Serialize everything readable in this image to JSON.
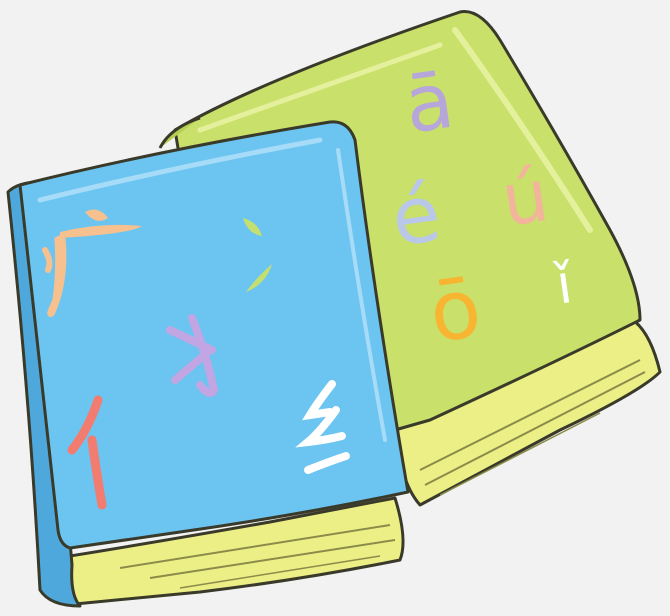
{
  "illustration": {
    "green_book": {
      "letters": [
        {
          "text": "ā",
          "color": "#b7a6d9"
        },
        {
          "text": "é",
          "color": "#b9c7e8"
        },
        {
          "text": "ú",
          "color": "#f2b49a"
        },
        {
          "text": "ǐ",
          "color": "#ffffff"
        },
        {
          "text": "ō",
          "color": "#f7b531"
        }
      ],
      "cover_color": "#c9e06a",
      "pages_color": "#ecef86"
    },
    "blue_book": {
      "radicals": [
        {
          "text": "广",
          "color": "#f7c08f"
        },
        {
          "text": "冫",
          "color": "#c3df70"
        },
        {
          "text": "扌",
          "color": "#c1a6e3"
        },
        {
          "text": "亻",
          "color": "#f27c70"
        },
        {
          "text": "纟",
          "color": "#ffffff"
        }
      ],
      "cover_color": "#6cc4f0",
      "pages_color": "#ecef86"
    },
    "background_color": "#f2f2f2"
  }
}
